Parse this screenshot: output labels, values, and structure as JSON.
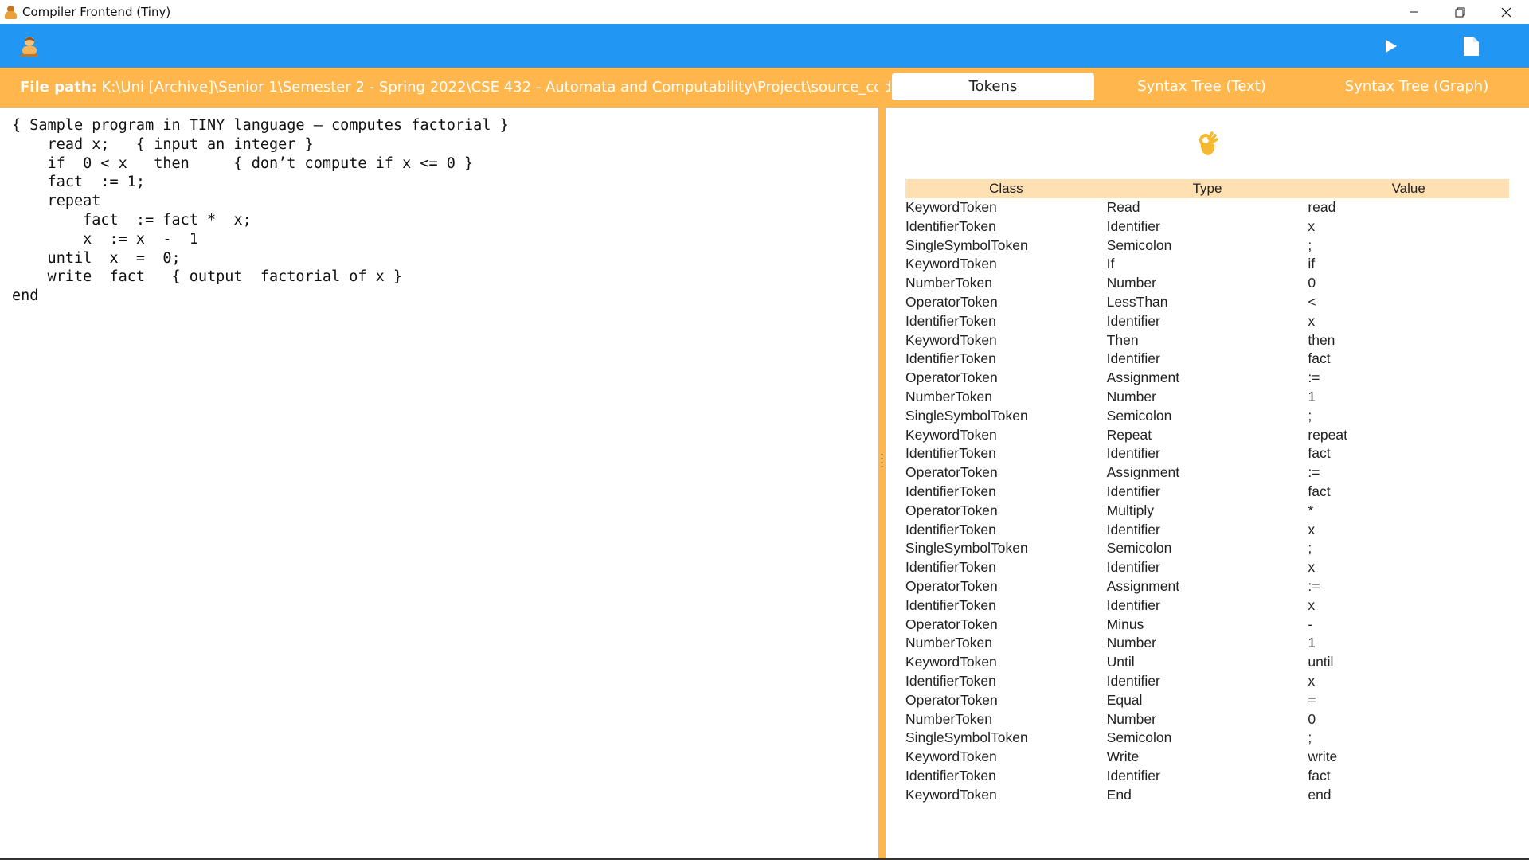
{
  "window": {
    "title": "Compiler Frontend (Tiny)"
  },
  "toolbar": {
    "left_icon": "user-icon",
    "run_icon": "play-icon",
    "file_icon": "document-icon"
  },
  "header": {
    "filepath_label": "File path:",
    "filepath_value": "K:\\Uni [Archive]\\Senior 1\\Semester 2 - Spring 2022\\CSE 432 - Automata and Computability\\Project\\source_code.tiny"
  },
  "tabs": [
    {
      "label": "Tokens",
      "active": true
    },
    {
      "label": "Syntax Tree (Text)",
      "active": false
    },
    {
      "label": "Syntax Tree (Graph)",
      "active": false
    }
  ],
  "editor": {
    "code": "{ Sample program in TINY language – computes factorial }\n    read x;   { input an integer }\n    if  0 < x   then     { don’t compute if x <= 0 }\n    fact  := 1;\n    repeat\n        fact  := fact *  x;\n        x  := x  -  1\n    until  x  =  0;\n    write  fact   { output  factorial of x }\nend"
  },
  "tokens": {
    "status_icon": "ok-hand-icon",
    "columns": [
      "Class",
      "Type",
      "Value"
    ],
    "rows": [
      [
        "KeywordToken",
        "Read",
        "read"
      ],
      [
        "IdentifierToken",
        "Identifier",
        "x"
      ],
      [
        "SingleSymbolToken",
        "Semicolon",
        ";"
      ],
      [
        "KeywordToken",
        "If",
        "if"
      ],
      [
        "NumberToken",
        "Number",
        "0"
      ],
      [
        "OperatorToken",
        "LessThan",
        "<"
      ],
      [
        "IdentifierToken",
        "Identifier",
        "x"
      ],
      [
        "KeywordToken",
        "Then",
        "then"
      ],
      [
        "IdentifierToken",
        "Identifier",
        "fact"
      ],
      [
        "OperatorToken",
        "Assignment",
        ":="
      ],
      [
        "NumberToken",
        "Number",
        "1"
      ],
      [
        "SingleSymbolToken",
        "Semicolon",
        ";"
      ],
      [
        "KeywordToken",
        "Repeat",
        "repeat"
      ],
      [
        "IdentifierToken",
        "Identifier",
        "fact"
      ],
      [
        "OperatorToken",
        "Assignment",
        ":="
      ],
      [
        "IdentifierToken",
        "Identifier",
        "fact"
      ],
      [
        "OperatorToken",
        "Multiply",
        "*"
      ],
      [
        "IdentifierToken",
        "Identifier",
        "x"
      ],
      [
        "SingleSymbolToken",
        "Semicolon",
        ";"
      ],
      [
        "IdentifierToken",
        "Identifier",
        "x"
      ],
      [
        "OperatorToken",
        "Assignment",
        ":="
      ],
      [
        "IdentifierToken",
        "Identifier",
        "x"
      ],
      [
        "OperatorToken",
        "Minus",
        "-"
      ],
      [
        "NumberToken",
        "Number",
        "1"
      ],
      [
        "KeywordToken",
        "Until",
        "until"
      ],
      [
        "IdentifierToken",
        "Identifier",
        "x"
      ],
      [
        "OperatorToken",
        "Equal",
        "="
      ],
      [
        "NumberToken",
        "Number",
        "0"
      ],
      [
        "SingleSymbolToken",
        "Semicolon",
        ";"
      ],
      [
        "KeywordToken",
        "Write",
        "write"
      ],
      [
        "IdentifierToken",
        "Identifier",
        "fact"
      ],
      [
        "KeywordToken",
        "End",
        "end"
      ]
    ]
  },
  "colors": {
    "toolbar": "#2196f3",
    "accent": "#ffb74d",
    "table_header": "#ffe0b2"
  }
}
